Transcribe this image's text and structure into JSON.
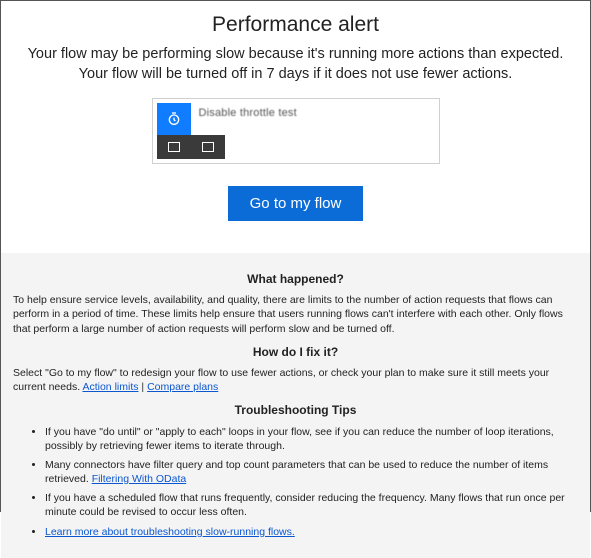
{
  "header": {
    "title": "Performance alert",
    "subtitle": "Your flow may be performing slow because it's running more actions than expected. Your flow will be turned off in 7 days if it does not use fewer actions."
  },
  "card": {
    "label": "Disable throttle test"
  },
  "button": {
    "label": "Go to my flow"
  },
  "info": {
    "what_heading": "What happened?",
    "what_body": "To help ensure service levels, availability, and quality, there are limits to the number of action requests that flows can perform in a period of time. These limits help ensure that users running flows can't interfere with each other. Only flows that perform a large number of action requests will perform slow and be turned off.",
    "fix_heading": "How do I fix it?",
    "fix_prefix": "Select \"Go to my flow\" to redesign your flow to use fewer actions, or check your plan to make sure it still meets your current needs. ",
    "link_action_limits": "Action limits",
    "separator": " | ",
    "link_compare_plans": "Compare plans",
    "tips_heading": "Troubleshooting Tips",
    "tips": [
      {
        "text": "If you have \"do until\" or \"apply to each\" loops in your flow, see if you can reduce the number of loop iterations, possibly by retrieving fewer items to iterate through."
      },
      {
        "prefix": "Many connectors have filter query and top count parameters that can be used to reduce the number of items retrieved. ",
        "link": "Filtering With OData"
      },
      {
        "text": "If you have a scheduled flow that runs frequently, consider reducing the frequency. Many flows that run once per minute could be revised to occur less often."
      },
      {
        "link_only": "Learn more about troubleshooting slow-running flows."
      }
    ]
  }
}
